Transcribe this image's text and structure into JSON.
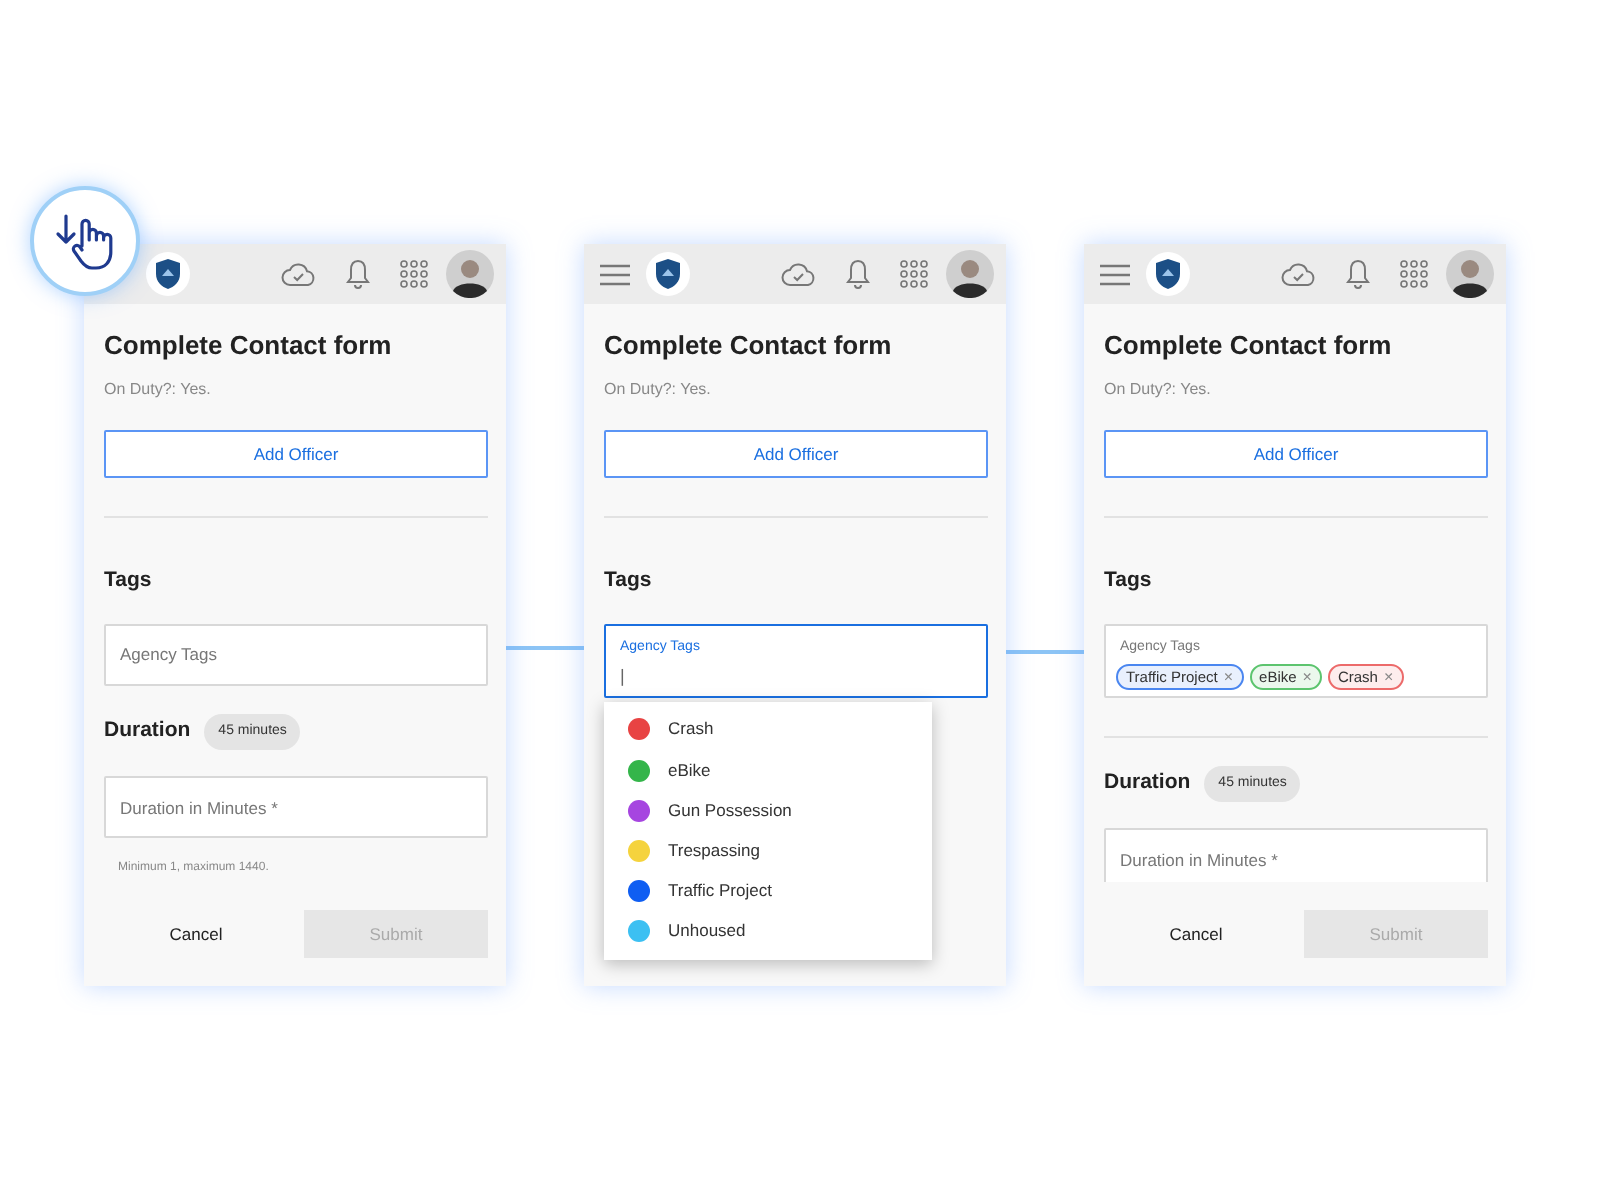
{
  "screens": [
    {
      "menu_icon": false,
      "title": "Complete Contact form",
      "status_line": "On Duty?: Yes.",
      "add_button": "Add Officer",
      "tags_heading": "Tags",
      "tags_field": {
        "kind": "empty",
        "placeholder": "Agency Tags"
      },
      "duration": {
        "heading": "Duration",
        "badge": "45 minutes",
        "placeholder": "Duration in Minutes *",
        "hint": "Minimum 1, maximum 1440."
      },
      "footer": {
        "cancel": "Cancel",
        "submit": "Submit",
        "submit_disabled": true
      }
    },
    {
      "menu_icon": true,
      "title": "Complete Contact form",
      "status_line": "On Duty?: Yes.",
      "add_button": "Add Officer",
      "tags_heading": "Tags",
      "tags_field": {
        "kind": "focused",
        "label": "Agency Tags",
        "cursor": "|"
      },
      "dropdown": [
        {
          "label": "Crash",
          "color": "#e84343"
        },
        {
          "label": "eBike",
          "color": "#34b54a"
        },
        {
          "label": "Gun Possession",
          "color": "#a645e0"
        },
        {
          "label": "Trespassing",
          "color": "#f5d33d"
        },
        {
          "label": "Traffic Project",
          "color": "#0f5ef2"
        },
        {
          "label": "Unhoused",
          "color": "#3cc0f2"
        }
      ]
    },
    {
      "menu_icon": true,
      "title": "Complete Contact form",
      "status_line": "On Duty?: Yes.",
      "add_button": "Add Officer",
      "tags_heading": "Tags",
      "tags_field": {
        "kind": "filled",
        "label": "Agency Tags",
        "chips": [
          {
            "label": "Traffic Project",
            "color": "#4a86f0",
            "remove": "×"
          },
          {
            "label": "eBike",
            "color": "#5cc46e",
            "remove": "×"
          },
          {
            "label": "Crash",
            "color": "#ec6a6a",
            "remove": "×"
          }
        ]
      },
      "divider_after_tags": true,
      "duration": {
        "heading": "Duration",
        "badge": "45 minutes",
        "placeholder": "Duration in Minutes *"
      },
      "footer": {
        "cancel": "Cancel",
        "submit": "Submit",
        "submit_disabled": true
      }
    }
  ]
}
